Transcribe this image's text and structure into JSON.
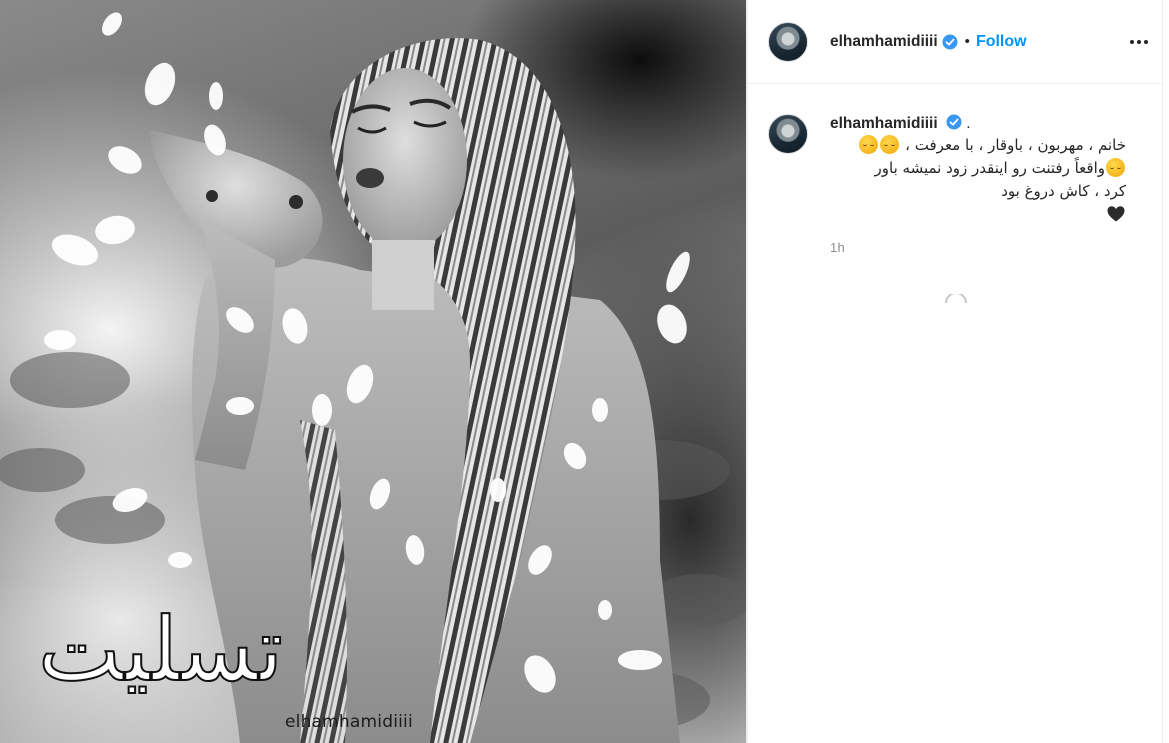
{
  "post": {
    "image_watermark": "elhamhamidiiii",
    "image_overlay_text": "تسلیت",
    "username": "elhamhamidiiii",
    "verified_badge_icon": "verified-check-icon",
    "separator": "•",
    "follow_label": "Follow",
    "more_icon": "more-options-icon"
  },
  "caption": {
    "username": "elhamhamidiiii",
    "suffix": ".",
    "line1": "خانم ، مهربون ، باوقار ، با معرفت ،",
    "line2": "واقعاً رفتنت رو اینقدر زود نمیشه باور",
    "line3": "کرد ، کاش دروغ بود",
    "emoji": "pensive-face-emoji",
    "heart": "black-heart-emoji",
    "time": "1h"
  },
  "colors": {
    "follow_blue": "#0095f6",
    "verified_blue": "#3897f0",
    "time_gray": "#8e8e8e"
  }
}
